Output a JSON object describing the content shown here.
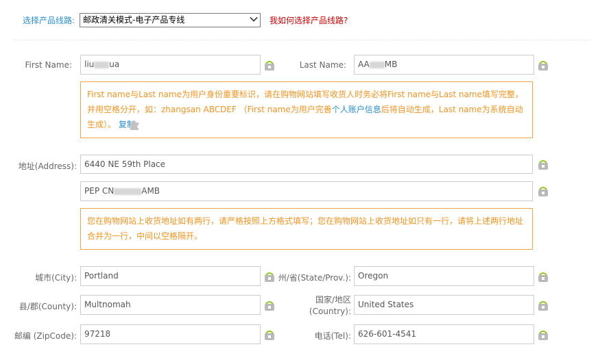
{
  "route": {
    "label": "选择产品线路:",
    "selected": "邮政清关模式-电子产品专线",
    "help": "我如何选择产品线路?"
  },
  "fields": {
    "first_name": {
      "label": "First Name:",
      "value_a": "liu",
      "value_b": "ua"
    },
    "last_name": {
      "label": "Last Name:",
      "value_a": "AA",
      "value_b": "MB"
    },
    "name_tip": {
      "text_a": "First name与Last name为用户身份重要标识，请在购物网站填写收货人时务必将First name与Last name填写完整，并用空格分开，如：zhangsan ABCDEF （First name为用户完善",
      "link": "个人账户信息",
      "text_b": "后将自动生成，Last name为系统自动生成）。",
      "copy": "复制"
    },
    "address": {
      "label": "地址(Address):",
      "line1": "6440 NE 59th Place",
      "line2_a": "PEP CN",
      "line2_b": "AMB"
    },
    "address_tip": "您在购物网站上收货地址如有两行，请严格按照上方格式填写；您在购物网站上收货地址如只有一行，请将上述两行地址合并为一行，中间以空格隔开。",
    "city": {
      "label": "城市(City):",
      "value": "Portland"
    },
    "state": {
      "label": "州/省(State/Prov.):",
      "value": "Oregon"
    },
    "county": {
      "label": "县/郡(County):",
      "value": "Multnomah"
    },
    "country": {
      "label_line1": "国家/地区",
      "label_line2": "(Country):",
      "value": "United States"
    },
    "zip": {
      "label": "邮编 (ZipCode):",
      "value": "97218"
    },
    "tel": {
      "label": "电话(Tel):",
      "value": "626-601-4541"
    }
  },
  "colors": {
    "accent_blue": "#2a8fd0",
    "warn_red": "#d00000",
    "tip_orange": "#f29420",
    "copy_icon_green": "#8fc31f"
  }
}
